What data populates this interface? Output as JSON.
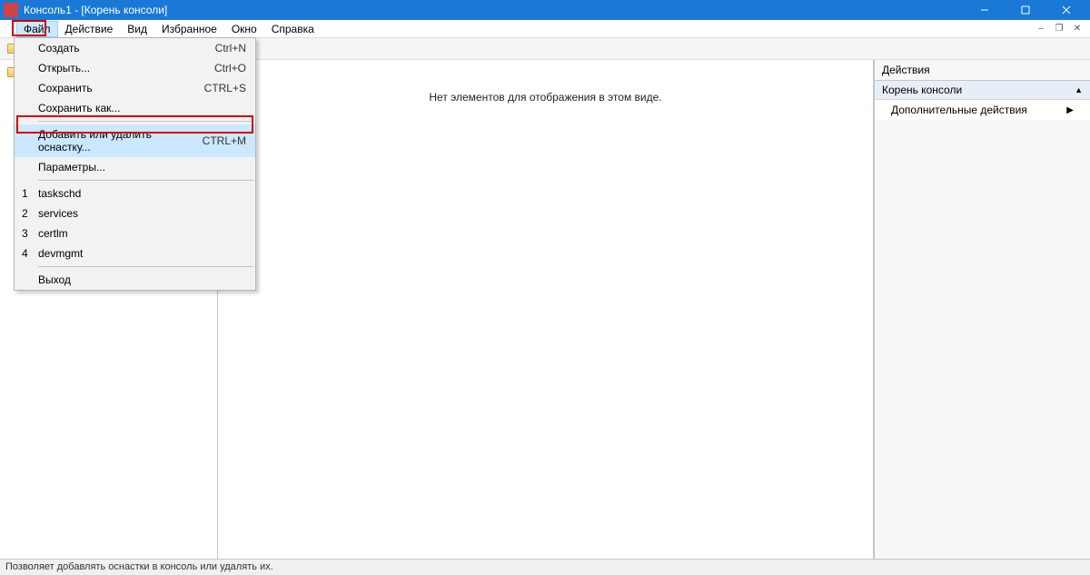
{
  "title": "Консоль1 - [Корень консоли]",
  "menubar": {
    "file": "Файл",
    "action": "Действие",
    "view": "Вид",
    "favorites": "Избранное",
    "window": "Окно",
    "help": "Справка"
  },
  "file_menu": {
    "create": {
      "label": "Создать",
      "shortcut": "Ctrl+N"
    },
    "open": {
      "label": "Открыть...",
      "shortcut": "Ctrl+O"
    },
    "save": {
      "label": "Сохранить",
      "shortcut": "CTRL+S"
    },
    "save_as": {
      "label": "Сохранить как..."
    },
    "add_remove": {
      "label": "Добавить или удалить оснастку...",
      "shortcut": "CTRL+M"
    },
    "params": {
      "label": "Параметры..."
    },
    "recent": [
      {
        "num": "1",
        "label": "taskschd"
      },
      {
        "num": "2",
        "label": "services"
      },
      {
        "num": "3",
        "label": "certlm"
      },
      {
        "num": "4",
        "label": "devmgmt"
      }
    ],
    "exit": {
      "label": "Выход"
    }
  },
  "tree": {
    "root": "Корень консоли"
  },
  "content": {
    "empty": "Нет элементов для отображения в этом виде."
  },
  "actions": {
    "title": "Действия",
    "section": "Корень консоли",
    "item": "Дополнительные действия"
  },
  "status": "Позволяет добавлять оснастки в консоль или удалять их."
}
